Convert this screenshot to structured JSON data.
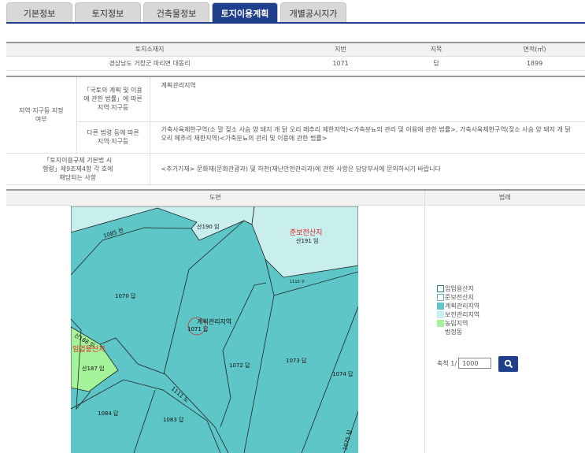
{
  "tabs": [
    "기본정보",
    "토지정보",
    "건축물정보",
    "토지이용계획",
    "개별공시지가"
  ],
  "parcel": {
    "headers": [
      "토지소재지",
      "지번",
      "지목",
      "면적(㎡)"
    ],
    "values": [
      "경상남도 거창군 마리면 대동리",
      "1071",
      "답",
      "1899"
    ]
  },
  "zoning": {
    "group_label": "지역·지구등 지정여부",
    "national_label": "「국토의 계획 및 이용에 관한 법률」에 따른 지역·지구등",
    "national_value": "계획관리지역",
    "other_label": "다른 법령 등에 따른 지역·지구등",
    "other_value": "가축사육제한구역(소 말 젖소 사슴 양 돼지 개 닭 오리 메추리 제한지역)<가축분뇨의 관리 및 이용에 관한 법률>, 가축사육제한구역(젖소 사슴 양 돼지 개 닭 오리 메추리 제한지역)<가축분뇨의 관리 및 이용에 관한 법률>",
    "article_label": "「토지이용규제 기본법 시행령」제9조제4항 각 호에 해당되는 사항",
    "article_value": "<추가기재> 문화재(문화관광과) 및 하천(재난안전관리과)에 관한 사항은 담당부서에 문의하시기 바랍니다"
  },
  "map": {
    "header": "도면",
    "labels": {
      "l1085": "1085 전",
      "l190": "산190 임",
      "zone_red": "준보전산지",
      "l191": "산191 임",
      "l1110": "1110 구",
      "l1070": "1070 답",
      "zone_center": "계획관리지역",
      "l1071": "1071 답",
      "l188": "산188 임",
      "zone_green": "임업용산지",
      "l187": "산187 임",
      "l1072": "1072 답",
      "l1073": "1073 답",
      "l1074": "1074 답",
      "l1111": "1111 도",
      "l1084": "1084 답",
      "l1083": "1083 답",
      "l1075": "1075 답"
    },
    "colors": {
      "plan": "#5ec6c6",
      "conservation": "#c9eeee",
      "farm": "#a4f29a"
    }
  },
  "legend": {
    "header": "범례",
    "items": [
      {
        "label": "임업용산지",
        "color": "#ffffff"
      },
      {
        "label": "준보전산지",
        "color": "#ffffff"
      },
      {
        "label": "계획관리지역",
        "color": "#5ec6c6"
      },
      {
        "label": "보전관리지역",
        "color": "#c9eeee"
      },
      {
        "label": "농림지역",
        "color": "#a4f29a"
      }
    ],
    "extra": "법정동",
    "scale_label": "축척 1/",
    "scale_value": "1000"
  }
}
